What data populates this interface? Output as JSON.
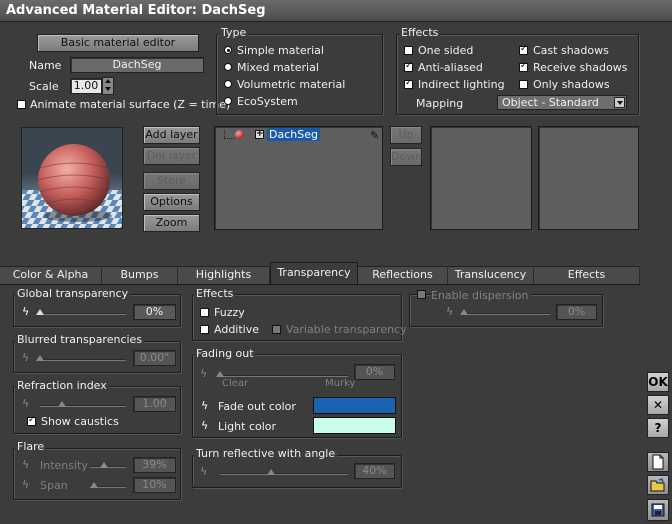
{
  "window": {
    "title": "Advanced Material Editor: DachSeg"
  },
  "top_left": {
    "basic_button": "Basic material editor",
    "name_label": "Name",
    "name_value": "DachSeg",
    "scale_label": "Scale",
    "scale_value": "1.00",
    "animate_label": "Animate material surface (Z = time)"
  },
  "type": {
    "title": "Type",
    "options": [
      "Simple material",
      "Mixed material",
      "Volumetric material",
      "EcoSystem"
    ],
    "selected": "Simple material"
  },
  "effects_top": {
    "title": "Effects",
    "one_sided": "One sided",
    "anti_aliased": "Anti-aliased",
    "indirect_lighting": "Indirect lighting",
    "cast_shadows": "Cast shadows",
    "receive_shadows": "Receive shadows",
    "only_shadows": "Only shadows",
    "mapping_label": "Mapping",
    "mapping_value": "Object - Standard"
  },
  "layer_buttons": {
    "add_layer": "Add layer",
    "del_layer": "Del layer",
    "store": "Store",
    "options": "Options",
    "zoom": "Zoom"
  },
  "tree": {
    "item": "DachSeg",
    "expand": "+"
  },
  "updown": {
    "up": "Up",
    "down": "Down"
  },
  "tabs": [
    "Color & Alpha",
    "Bumps",
    "Highlights",
    "Transparency",
    "Reflections",
    "Translucency",
    "Effects"
  ],
  "active_tab": "Transparency",
  "global_transparency": {
    "title": "Global transparency",
    "value": "0%"
  },
  "blurred": {
    "title": "Blurred transparencies",
    "value": "0.00\""
  },
  "refraction": {
    "title": "Refraction index",
    "value": "1.00",
    "show_caustics": "Show caustics"
  },
  "flare": {
    "title": "Flare",
    "intensity_label": "Intensity",
    "intensity_value": "39%",
    "span_label": "Span",
    "span_value": "10%"
  },
  "effects_mid": {
    "title": "Effects",
    "fuzzy": "Fuzzy",
    "additive": "Additive",
    "variable": "Variable transparency"
  },
  "fading": {
    "title": "Fading out",
    "value": "0%",
    "clear": "Clear",
    "murky": "Murky",
    "fade_color_label": "Fade out color",
    "light_color_label": "Light color",
    "fade_color": "#1a63b0",
    "light_color": "#c8fcec"
  },
  "reflective": {
    "title": "Turn reflective with angle",
    "value": "40%"
  },
  "dispersion": {
    "label": "Enable dispersion",
    "value": "0%"
  },
  "side": {
    "ok": "OK",
    "close": "✕",
    "help": "?"
  },
  "sliders": {
    "global_transparency": 0.0,
    "blurred": 0.0,
    "refraction": 0.25,
    "flare_intensity": 0.39,
    "flare_span": 0.1,
    "fading": 0.0,
    "reflective": 0.4,
    "dispersion": 0.0
  },
  "icons": {
    "bolt": "lightning-icon",
    "new": "new-document-icon",
    "open": "open-folder-icon",
    "save": "save-disk-icon"
  }
}
